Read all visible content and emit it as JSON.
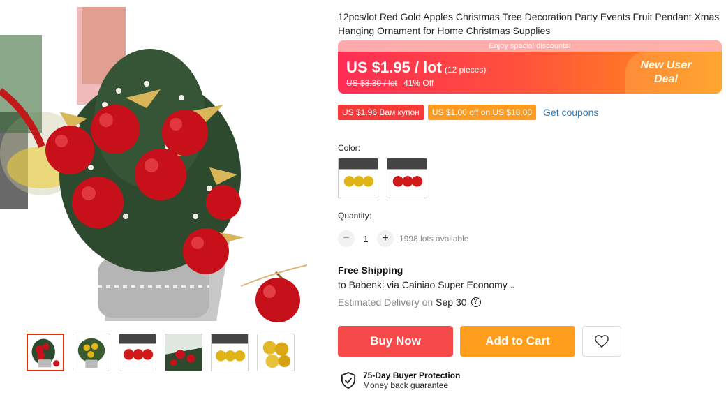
{
  "product": {
    "title": "12pcs/lot Red Gold Apples Christmas Tree Decoration Party Events Fruit Pendant Xmas Hanging Ornament for Home Christmas Supplies"
  },
  "price": {
    "promo": "Enjoy special discounts!",
    "current": "US $1.95 / lot",
    "pieces": "(12 pieces)",
    "original": "US $3.30 / lot",
    "discount": "41% Off",
    "badge": "New User Deal"
  },
  "coupons": {
    "items": [
      {
        "label": "US $1.96 Вам купон",
        "color": "#f63a3a"
      },
      {
        "label": "US $1.00 off on US $18.00",
        "color": "#ff9b20"
      }
    ],
    "link": "Get coupons"
  },
  "color": {
    "label": "Color:",
    "options": [
      {
        "name": "gold",
        "hex": "#e0b416"
      },
      {
        "name": "red",
        "hex": "#cf1a1a"
      }
    ]
  },
  "quantity": {
    "label": "Quantity:",
    "value": "1",
    "minus": "−",
    "plus": "+",
    "available": "1998 lots available"
  },
  "shipping": {
    "title": "Free Shipping",
    "to": "to Babenki via Cainiao Super Economy",
    "chevron": "⌄",
    "eta_label": "Estimated Delivery on",
    "eta_date": "Sep 30",
    "help": "?"
  },
  "actions": {
    "buy_now": "Buy Now",
    "add_to_cart": "Add to Cart"
  },
  "protection": {
    "title": "75-Day Buyer Protection",
    "subtitle": "Money back guarantee"
  },
  "gallery": {
    "thumbnails": [
      "mini-tree",
      "gold-tree",
      "red-apples",
      "tree-closeup",
      "gold-apples",
      "gold-apples-closeup"
    ],
    "active": 0
  },
  "icons": {
    "wishlist": "heart-icon",
    "protection": "shield-check-icon"
  },
  "colors": {
    "accent": "#f64a4a",
    "cart": "#ff9d1c",
    "link": "#2e7bb8"
  }
}
